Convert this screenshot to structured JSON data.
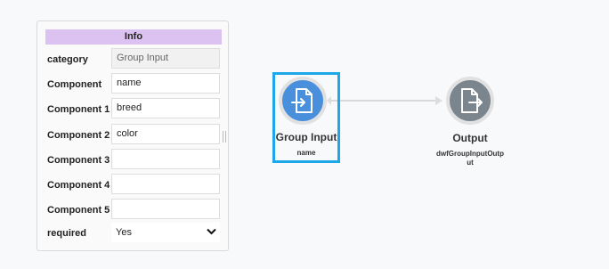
{
  "info_panel": {
    "header": "Info",
    "rows": [
      {
        "label": "category",
        "value": "Group Input"
      },
      {
        "label": "Component",
        "value": "name"
      },
      {
        "label": "Component 1",
        "value": "breed"
      },
      {
        "label": "Component 2",
        "value": "color"
      },
      {
        "label": "Component 3",
        "value": ""
      },
      {
        "label": "Component 4",
        "value": ""
      },
      {
        "label": "Component 5",
        "value": ""
      },
      {
        "label": "required",
        "value": "Yes"
      }
    ]
  },
  "graph": {
    "nodes": [
      {
        "title": "Group Input",
        "subtitle": "name",
        "icon": "file-import-icon",
        "color": "#4a8fdc",
        "selected": true
      },
      {
        "title": "Output",
        "subtitle": "dwfGroupInputOutput",
        "icon": "file-export-icon",
        "color": "#7b858d",
        "selected": false
      }
    ],
    "selection_color": "#1ea7e8",
    "edge_color": "#d9d9d9"
  }
}
